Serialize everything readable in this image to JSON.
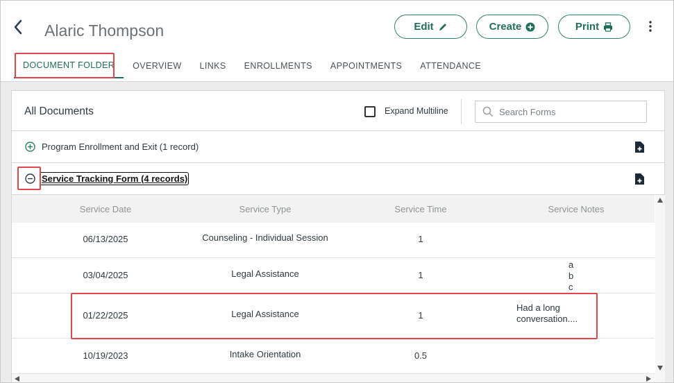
{
  "header": {
    "title": "Alaric Thompson",
    "edit_label": "Edit",
    "create_label": "Create",
    "print_label": "Print"
  },
  "tabs": [
    {
      "label": "DOCUMENT FOLDER",
      "active": true
    },
    {
      "label": "OVERVIEW"
    },
    {
      "label": "LINKS"
    },
    {
      "label": "ENROLLMENTS"
    },
    {
      "label": "APPOINTMENTS"
    },
    {
      "label": "ATTENDANCE"
    }
  ],
  "panel": {
    "title": "All Documents",
    "expand_label": "Expand Multiline",
    "expand_checked": false,
    "search_placeholder": "Search Forms"
  },
  "sections": [
    {
      "label": "Program Enrollment and Exit (1 record)",
      "expanded": false
    },
    {
      "label": "Service Tracking Form (4 records)",
      "expanded": true
    }
  ],
  "table": {
    "columns": [
      "Service Date",
      "Service Type",
      "Service Time",
      "Service Notes"
    ],
    "rows": [
      {
        "date": "06/13/2025",
        "type": "Counseling - Individual Session",
        "time": "1",
        "notes": ""
      },
      {
        "date": "03/04/2025",
        "type": "Legal Assistance",
        "time": "1",
        "notes": "a\nb\nc"
      },
      {
        "date": "01/22/2025",
        "type": "Legal Assistance",
        "time": "1",
        "notes": "Had a long\nconversation...."
      },
      {
        "date": "10/19/2023",
        "type": "Intake Orientation",
        "time": "0.5",
        "notes": ""
      }
    ]
  },
  "colors": {
    "accent": "#1f6f5b",
    "highlight": "#e0474c"
  },
  "icons": [
    "back-arrow-icon",
    "pencil-icon",
    "plus-circle-icon",
    "printer-icon",
    "kebab-menu-icon",
    "search-icon",
    "plus-circle-outline-icon",
    "minus-circle-outline-icon",
    "add-document-icon"
  ]
}
